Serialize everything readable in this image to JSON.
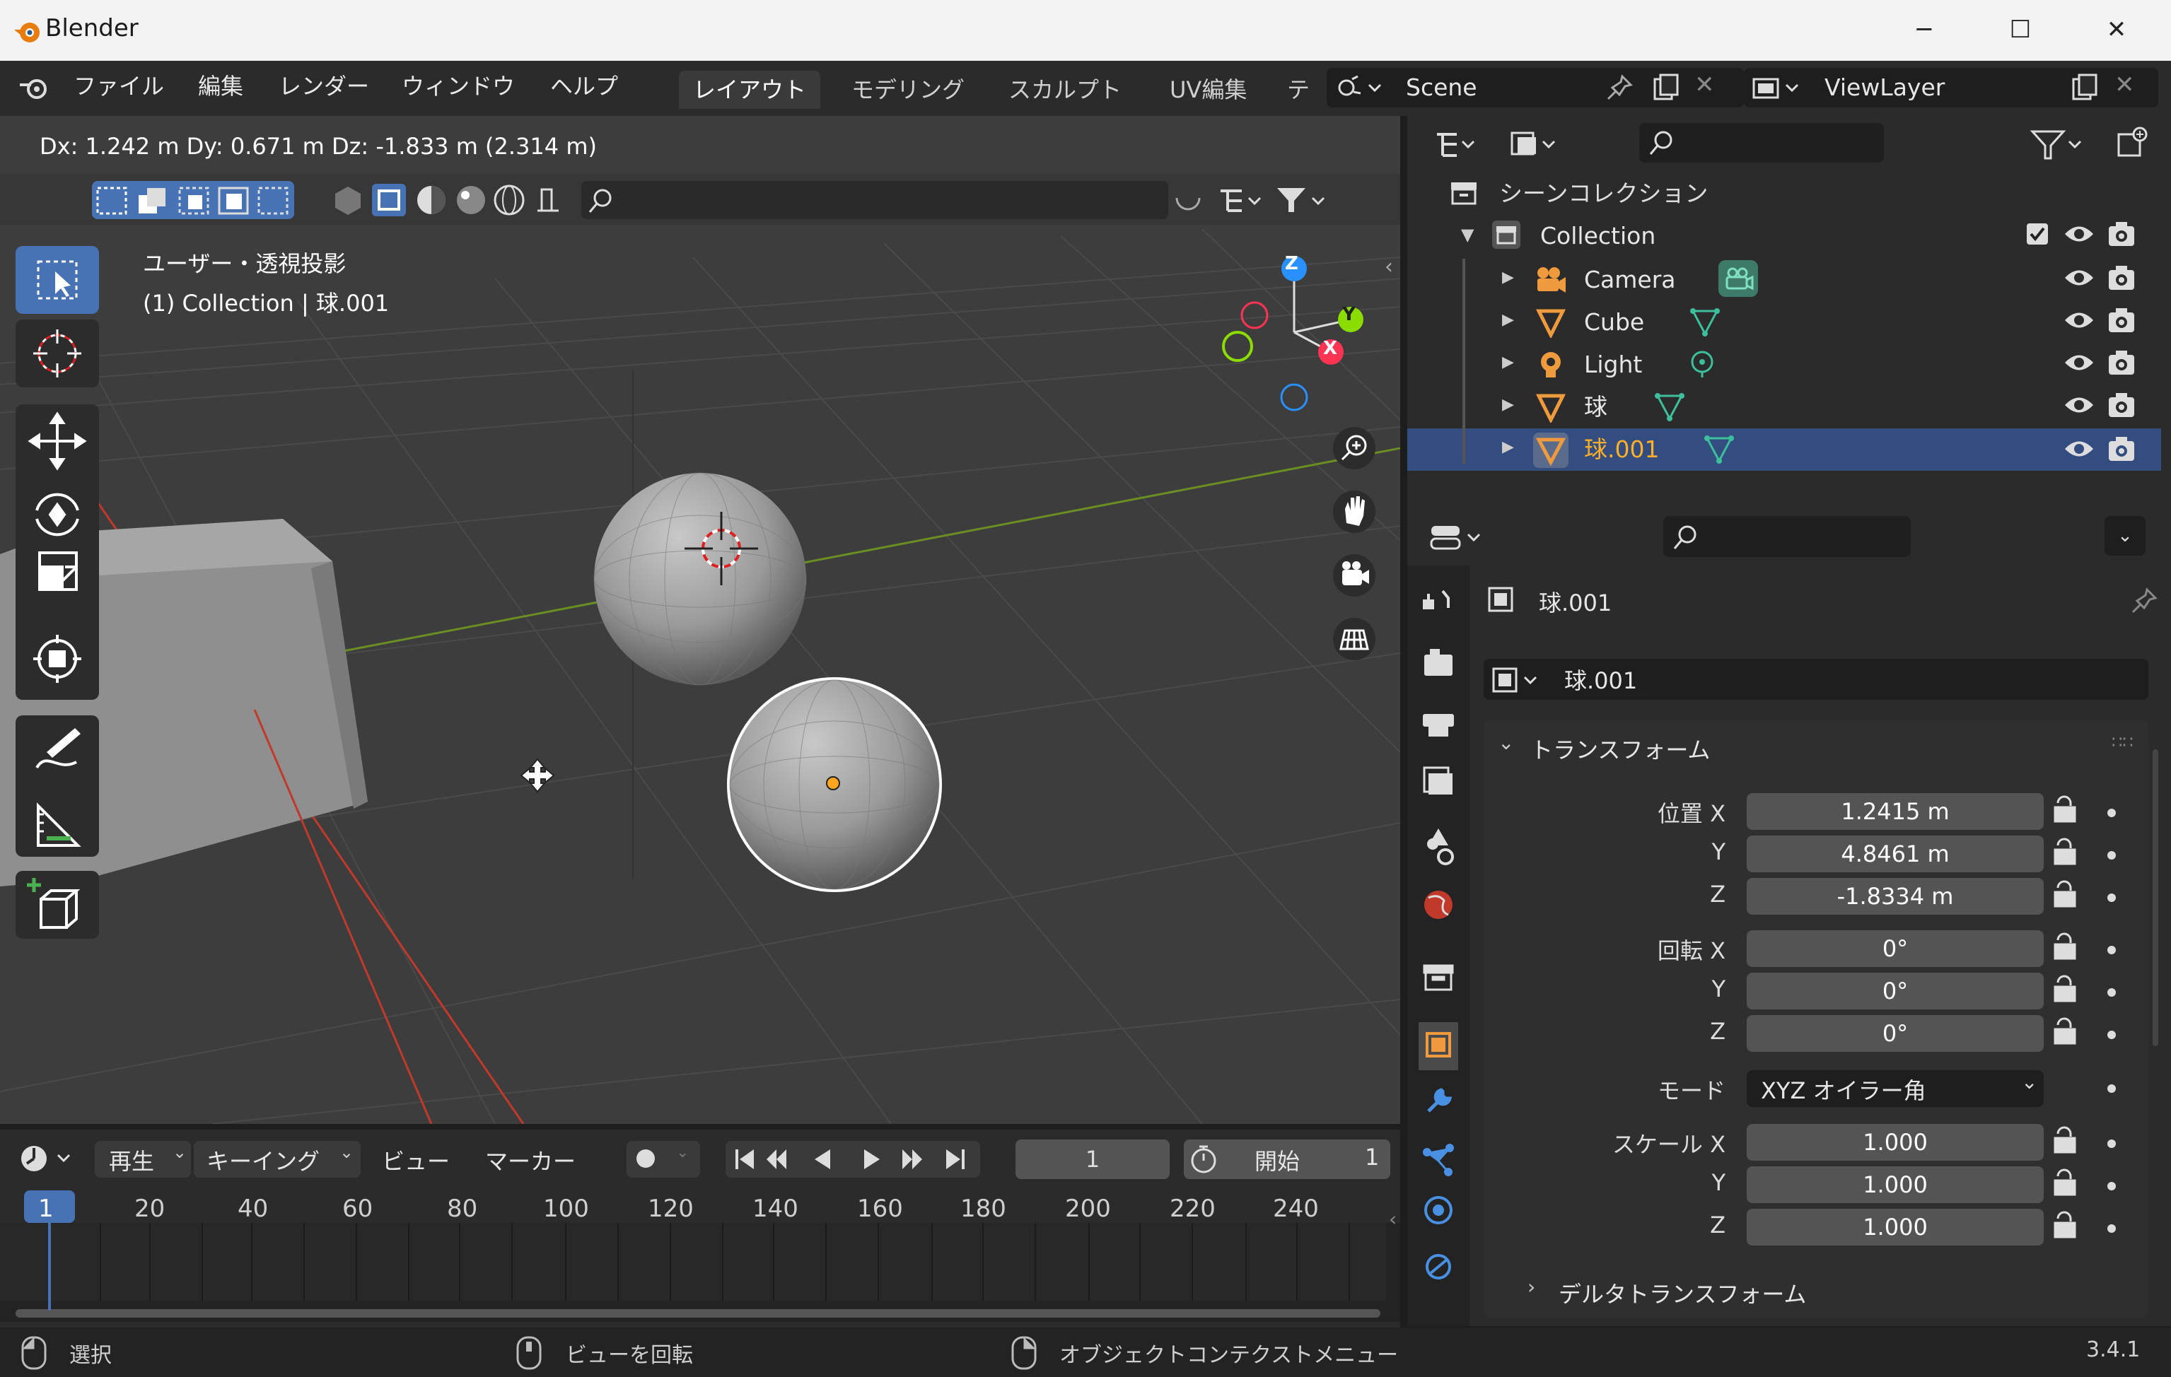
{
  "window": {
    "title": "Blender",
    "minimize": "─",
    "maximize": "☐",
    "close": "✕"
  },
  "menu": [
    "ファイル",
    "編集",
    "レンダー",
    "ウィンドウ",
    "ヘルプ"
  ],
  "workspaces": [
    "レイアウト",
    "モデリング",
    "スカルプト",
    "UV編集",
    "テ"
  ],
  "scene": {
    "name": "Scene",
    "viewlayer": "ViewLayer"
  },
  "viewport": {
    "transform_readout": "Dx: 1.242 m   Dy: 0.671 m   Dz: -1.833 m (2.314 m)",
    "view_name": "ユーザー・透視投影",
    "context": "(1) Collection | 球.001",
    "gizmo": {
      "z": "Z",
      "y": "Y",
      "x": "X"
    }
  },
  "outliner": {
    "root": "シーンコレクション",
    "collection": "Collection",
    "items": [
      {
        "label": "Camera",
        "type": "camera"
      },
      {
        "label": "Cube",
        "type": "mesh"
      },
      {
        "label": "Light",
        "type": "light"
      },
      {
        "label": "球",
        "type": "mesh"
      },
      {
        "label": "球.001",
        "type": "mesh",
        "selected": true
      }
    ]
  },
  "properties": {
    "object_name": "球.001",
    "data_name": "球.001",
    "panel_transform": "トランスフォーム",
    "location_label": "位置 X",
    "rotation_label": "回転 X",
    "scale_label": "スケール X",
    "y": "Y",
    "z": "Z",
    "location": [
      "1.2415 m",
      "4.8461 m",
      "-1.8334 m"
    ],
    "rotation": [
      "0°",
      "0°",
      "0°"
    ],
    "mode_label": "モード",
    "mode_value": "XYZ オイラー角",
    "scale": [
      "1.000",
      "1.000",
      "1.000"
    ],
    "delta_panel": "デルタトランスフォーム"
  },
  "timeline": {
    "menu": [
      "再生",
      "キーイング",
      "ビュー",
      "マーカー"
    ],
    "current_frame": "1",
    "start_label": "開始",
    "start_value": "1",
    "ticks": [
      "1",
      "20",
      "40",
      "60",
      "80",
      "100",
      "120",
      "140",
      "160",
      "180",
      "200",
      "220",
      "240"
    ]
  },
  "status": {
    "select": "選択",
    "rotate": "ビューを回転",
    "context_menu": "オブジェクトコンテクストメニュー",
    "version": "3.4.1"
  },
  "colors": {
    "accent": "#4772b3",
    "selected_text": "#ffaf29",
    "axis_x": "#ff3352",
    "axis_y": "#8bdc00",
    "axis_z": "#2890ff"
  }
}
